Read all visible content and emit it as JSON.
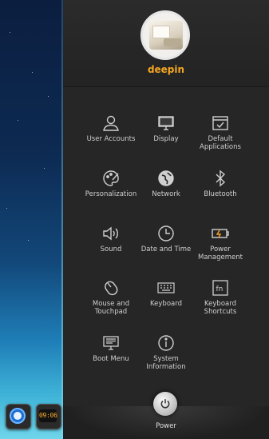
{
  "desktop": {
    "clock_icon_time": "09:06"
  },
  "user": {
    "name": "deepin"
  },
  "settings_items": [
    {
      "label": "User Accounts",
      "icon": "user-icon"
    },
    {
      "label": "Display",
      "icon": "monitor-icon"
    },
    {
      "label": "Default\nApplications",
      "icon": "default-apps-icon"
    },
    {
      "label": "Personalization",
      "icon": "palette-icon"
    },
    {
      "label": "Network",
      "icon": "globe-icon"
    },
    {
      "label": "Bluetooth",
      "icon": "bluetooth-icon"
    },
    {
      "label": "Sound",
      "icon": "speaker-icon"
    },
    {
      "label": "Date and Time",
      "icon": "clock-icon"
    },
    {
      "label": "Power\nManagement",
      "icon": "battery-icon"
    },
    {
      "label": "Mouse and\nTouchpad",
      "icon": "mouse-icon"
    },
    {
      "label": "Keyboard",
      "icon": "keyboard-icon"
    },
    {
      "label": "Keyboard\nShortcuts",
      "icon": "fn-key-icon"
    },
    {
      "label": "Boot Menu",
      "icon": "boot-monitor-icon"
    },
    {
      "label": "System\nInformation",
      "icon": "info-icon"
    }
  ],
  "power": {
    "label": "Power",
    "icon": "power-icon"
  },
  "colors": {
    "accent": "#f5a623",
    "panel_bg": "#262626",
    "icon": "#cfcfcf"
  }
}
